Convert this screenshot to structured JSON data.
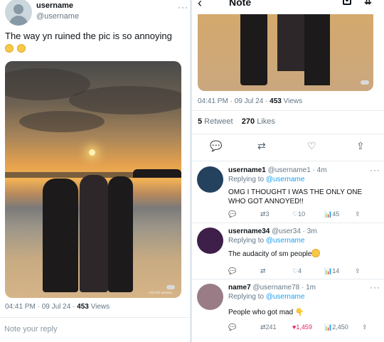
{
  "left": {
    "username": "username",
    "handle": "@username",
    "more": "···",
    "text": "The way yn ruined the pic is so annoying",
    "emoji_icons": [
      "grimacing-face-icon",
      "grimacing-face-icon"
    ],
    "timestamp": "04:41 PM · 09 Jul 24 · ",
    "views_count": "453",
    "views_label": " Views",
    "reply_placeholder": "Note your reply",
    "photo_watermark": "小红书号 3603958",
    "photo_badge_icon": "xiaohongshu-badge-icon"
  },
  "right": {
    "back_icon": "back-arrow-icon",
    "title": "Note",
    "camera_icon": "camera-icon",
    "sort_icon": "sort-icon",
    "timestamp": "04:41 PM · 09 Jul 24 · ",
    "views_count": "453",
    "views_label": " Views",
    "retweets_count": "5",
    "retweets_label": " Retweet",
    "likes_count": "270",
    "likes_label": " Likes",
    "actions": [
      "reply-icon",
      "retweet-icon",
      "heart-icon",
      "share-icon"
    ],
    "replies": [
      {
        "name": "username1",
        "handle": "@username1",
        "time": "4m",
        "replying_to": "Replying to ",
        "replying_user": "@username",
        "text": "OMG I THOUGHT I WAS THE ONLY ONE WHO GOT ANNOYED!!",
        "retweets": "3",
        "likes": "10",
        "views": "45",
        "avatar_color": "#24415e"
      },
      {
        "name": "username34",
        "handle": "@user34",
        "time": "3m",
        "replying_to": "Replying to ",
        "replying_user": "@username",
        "text": "The audacity of sm people",
        "retweets": "",
        "likes": "4",
        "views": "14",
        "avatar_color": "#3d1f4a"
      },
      {
        "name": "name7",
        "handle": "@username78",
        "time": "1m",
        "replying_to": "Replying to ",
        "replying_user": "@username",
        "text": "People who got mad",
        "retweets": "241",
        "likes": "1,459",
        "views": "2,450",
        "avatar_color": "#9a7c86"
      }
    ]
  }
}
